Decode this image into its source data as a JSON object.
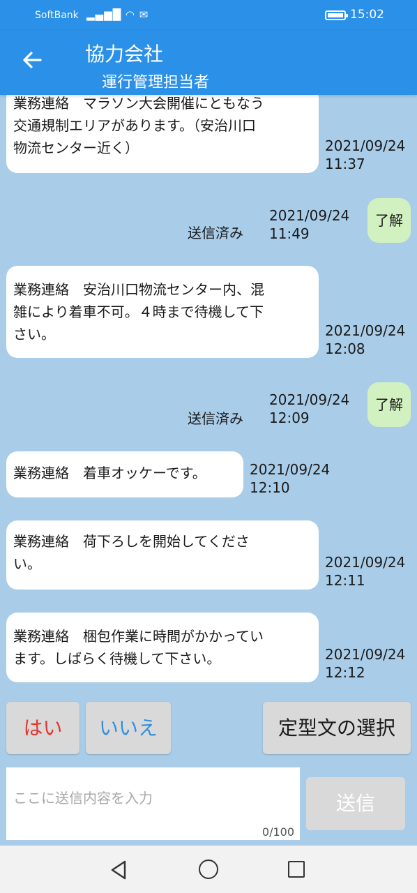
{
  "status_bar": {
    "carrier": "SoftBank",
    "time": "15:02"
  },
  "header": {
    "title": "協力会社",
    "subtitle": "運行管理担当者"
  },
  "messages": [
    {
      "text": "業務連絡　マラソン大会開催にともなう\n交通規制エリアがあります。（安治川口\n物流センター近く）",
      "date": "2021/09/24",
      "time": "11:37"
    },
    {
      "status": "送信済み",
      "date": "2021/09/24",
      "time": "11:49",
      "reply": "了解"
    },
    {
      "text": "業務連絡　安治川口物流センター内、混\n雑により着車不可。４時まで待機して下\nさい。",
      "date": "2021/09/24",
      "time": "12:08"
    },
    {
      "status": "送信済み",
      "date": "2021/09/24",
      "time": "12:09",
      "reply": "了解"
    },
    {
      "text": "業務連絡　着車オッケーです。",
      "date": "2021/09/24",
      "time": "12:10"
    },
    {
      "text": "業務連絡　荷下ろしを開始してくださ\nい。",
      "date": "2021/09/24",
      "time": "12:11"
    },
    {
      "text": "業務連絡　梱包作業に時間がかかってい\nます。しばらく待機して下さい。",
      "date": "2021/09/24",
      "time": "12:12"
    }
  ],
  "quick_replies": {
    "yes": "はい",
    "no": "いいえ",
    "template": "定型文の選択"
  },
  "composer": {
    "placeholder": "ここに送信内容を入力",
    "counter": "0/100",
    "send_label": "送信"
  },
  "colors": {
    "accent": "#2b90e8",
    "chat_background": "#a9cde9",
    "sent_bubble": "#d2f1c0",
    "yes_text": "#e8322a",
    "no_text": "#2f8fde"
  }
}
